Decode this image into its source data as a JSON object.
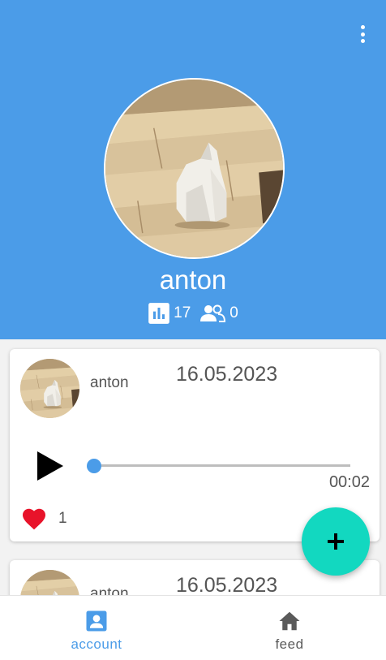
{
  "profile": {
    "username": "anton",
    "stats": {
      "posts": "17",
      "followers": "0"
    }
  },
  "posts": [
    {
      "user": "anton",
      "date": "16.05.2023",
      "duration": "00:02",
      "likes": "1",
      "progress": 0.0
    },
    {
      "user": "anton",
      "date": "16.05.2023"
    }
  ],
  "nav": [
    {
      "label": "account",
      "icon": "account-box-icon",
      "active": true
    },
    {
      "label": "feed",
      "icon": "home-icon",
      "active": false
    }
  ],
  "colors": {
    "primary": "#4b9ce8",
    "fab": "#12d8c0",
    "like": "#e8132a"
  }
}
